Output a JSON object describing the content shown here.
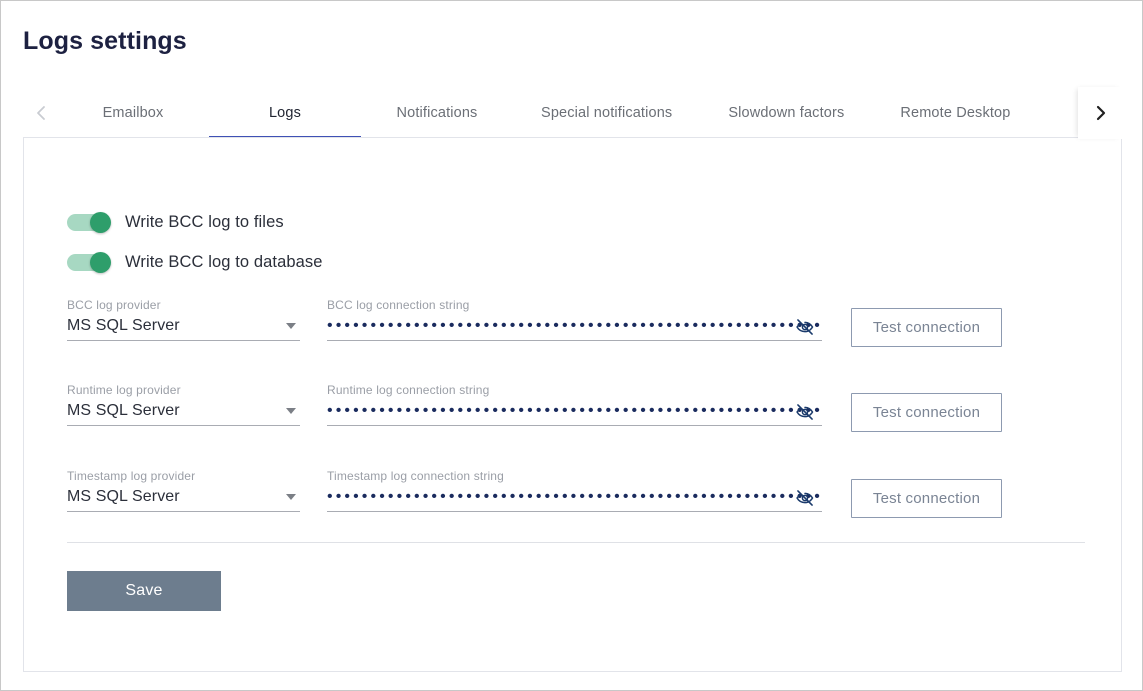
{
  "page": {
    "title": "Logs settings"
  },
  "tabs": {
    "prev_icon": "chevron-left-icon",
    "next_icon": "chevron-right-icon",
    "active_index": 1,
    "items": [
      {
        "label": "Emailbox"
      },
      {
        "label": "Logs"
      },
      {
        "label": "Notifications"
      },
      {
        "label": "Special notifications"
      },
      {
        "label": "Slowdown factors"
      },
      {
        "label": "Remote Desktop"
      }
    ]
  },
  "toggles": [
    {
      "label": "Write BCC log to files",
      "on": true
    },
    {
      "label": "Write BCC log to database",
      "on": true
    }
  ],
  "rows": [
    {
      "provider_label": "BCC log provider",
      "provider_value": "MS SQL Server",
      "conn_label": "BCC log connection string",
      "conn_value": "••••••••••••••••••••••••••••••••••••••••••••••••••••••••••••••••••••••••••••••••••••••••••••••••••",
      "conn_icon": "eye-off-icon",
      "test_label": "Test connection"
    },
    {
      "provider_label": "Runtime log provider",
      "provider_value": "MS SQL Server",
      "conn_label": "Runtime log connection string",
      "conn_value": "••••••••••••••••••••••••••••••••••••••••••••••••••••••••••••••••••••••••••••••••••••••••••••••••••",
      "conn_icon": "eye-off-icon",
      "test_label": "Test connection"
    },
    {
      "provider_label": "Timestamp log provider",
      "provider_value": "MS SQL Server",
      "conn_label": "Timestamp log connection string",
      "conn_value": "••••••••••••••••••••••••••••••••••••••••••••••••••••••••••••••••••••••••••••••••••••••••••••••••••",
      "conn_icon": "eye-off-icon",
      "test_label": "Test connection"
    }
  ],
  "footer": {
    "save_label": "Save"
  },
  "colors": {
    "accent": "#3f51b5",
    "toggle_on": "#2e9e6b",
    "toggle_track": "#a7d8c2",
    "save_bg": "#6d7d8e",
    "title": "#1d2141"
  }
}
